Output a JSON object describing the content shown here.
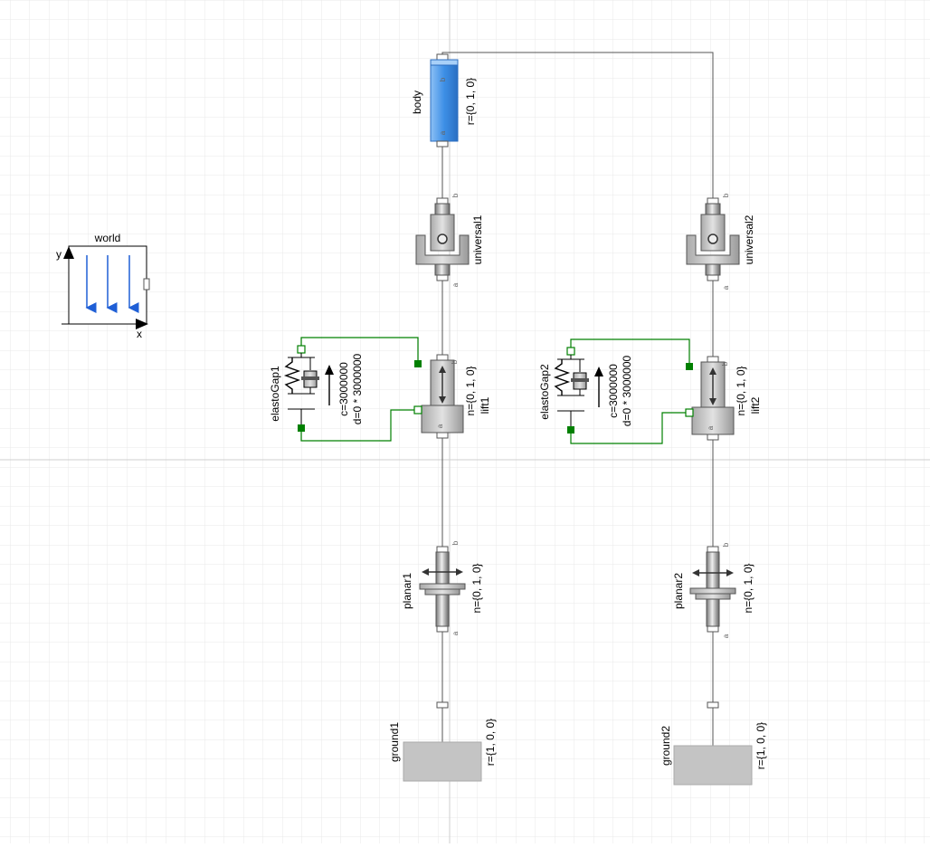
{
  "world": {
    "title": "world",
    "axis_x": "x",
    "axis_y": "y"
  },
  "body": {
    "name": "body",
    "param": "r={0, 1, 0}",
    "port_a": "a",
    "port_b": "b"
  },
  "universal1": {
    "name": "universal1",
    "port_a": "a",
    "port_b": "b"
  },
  "universal2": {
    "name": "universal2",
    "port_a": "a",
    "port_b": "b"
  },
  "lift1": {
    "name": "lift1",
    "param": "n={0, 1, 0}",
    "port_a": "a",
    "port_b": "b"
  },
  "lift2": {
    "name": "lift2",
    "param": "n={0, 1, 0}",
    "port_a": "a",
    "port_b": "b"
  },
  "elastoGap1": {
    "name": "elastoGap1",
    "c": "c=3000000",
    "d": "d=0 * 3000000"
  },
  "elastoGap2": {
    "name": "elastoGap2",
    "c": "c=3000000",
    "d": "d=0 * 3000000"
  },
  "planar1": {
    "name": "planar1",
    "param": "n={0, 1, 0}",
    "port_a": "a",
    "port_b": "b"
  },
  "planar2": {
    "name": "planar2",
    "param": "n={0, 1, 0}",
    "port_a": "a",
    "port_b": "b"
  },
  "ground1": {
    "name": "ground1",
    "param": "r={1, 0, 0}"
  },
  "ground2": {
    "name": "ground2",
    "param": "r={1, 0, 0}"
  },
  "colors": {
    "grid": "#e6e6e6",
    "grid_major": "#c8c8c8",
    "body_blue": "#3d8fe6",
    "gray": "#c4c4c4",
    "green": "#008000",
    "arrow_blue": "#1f5fd6"
  }
}
